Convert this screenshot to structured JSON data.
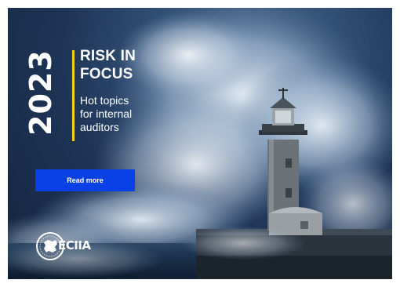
{
  "hero": {
    "year": "2023",
    "title_line1": "RISK IN",
    "title_line2": "FOCUS",
    "subtitle_line1": "Hot topics",
    "subtitle_line2": "for internal",
    "subtitle_line3": "auditors",
    "cta_label": "Read more",
    "background_image": "storm-waves-lighthouse"
  },
  "logo": {
    "text": "ECIIA",
    "icon": "globe-europe-icon"
  },
  "colors": {
    "accent_yellow": "#f3d21d",
    "button_blue": "#0a41e6",
    "text": "#ffffff"
  }
}
